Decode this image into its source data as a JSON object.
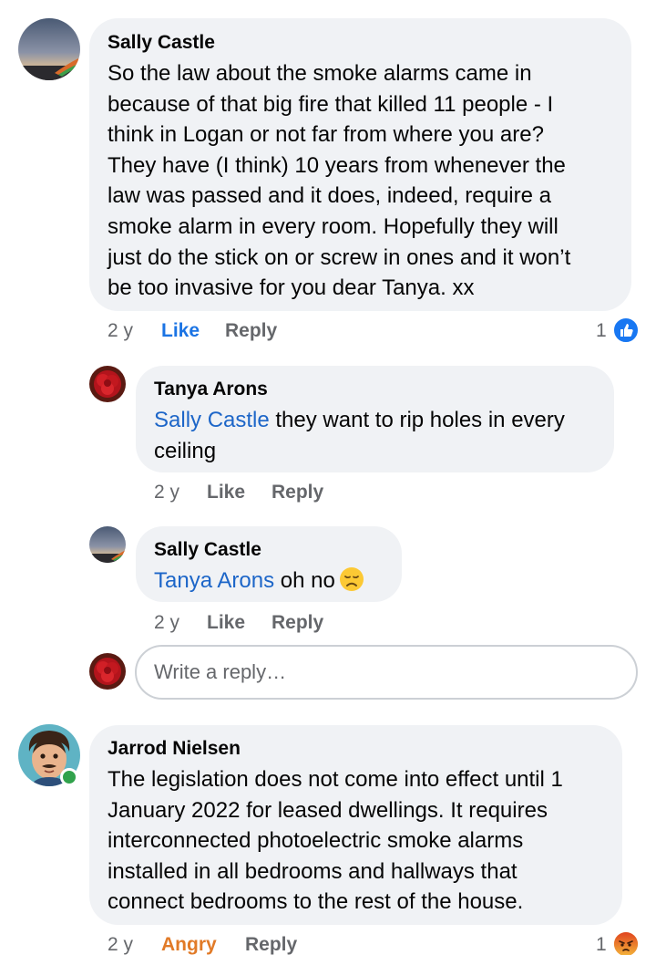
{
  "comments": [
    {
      "author": "Sally Castle",
      "text": "So the law about the smoke alarms came in\nbecause of that big fire that killed 11 people - I\nthink in Logan or not far from where you are?\nThey have (I think) 10 years from whenever the\nlaw was passed and it does, indeed, require a\nsmoke alarm in every room.  Hopefully they will\njust do the stick on or screw in ones and it won’t\nbe too invasive for you dear Tanya. xx",
      "time": "2 y",
      "reaction_label": "Like",
      "reply_label": "Reply",
      "reaction_count": "1",
      "reaction_icon": "like-icon",
      "reaction_color": "#1877f2",
      "replies": [
        {
          "author": "Tanya Arons",
          "mention": "Sally Castle",
          "text": " they want to rip holes in every\nceiling",
          "time": "2 y",
          "like_label": "Like",
          "reply_label": "Reply"
        },
        {
          "author": "Sally Castle",
          "mention": "Tanya Arons",
          "text": " oh no",
          "emoji": "disappointed-face-icon",
          "time": "2 y",
          "like_label": "Like",
          "reply_label": "Reply"
        }
      ],
      "reply_box": {
        "placeholder": "Write a reply…"
      }
    },
    {
      "author": "Jarrod Nielsen",
      "text": "The legislation does not come into effect until 1\nJanuary 2022 for leased dwellings. It requires\ninterconnected photoelectric smoke alarms\ninstalled in all bedrooms and hallways that\nconnect bedrooms to the rest of the house.",
      "time": "2 y",
      "reaction_label": "Angry",
      "reply_label": "Reply",
      "reaction_count": "1",
      "reaction_icon": "angry-face-icon",
      "reaction_color": "#e9710f",
      "online_status_color": "#31a24c"
    }
  ],
  "colors": {
    "bubble": "#f0f2f5",
    "mention": "#1d66c8",
    "meta": "#65676b",
    "like_active": "#1b74e4",
    "angry_active": "#e17a27"
  }
}
